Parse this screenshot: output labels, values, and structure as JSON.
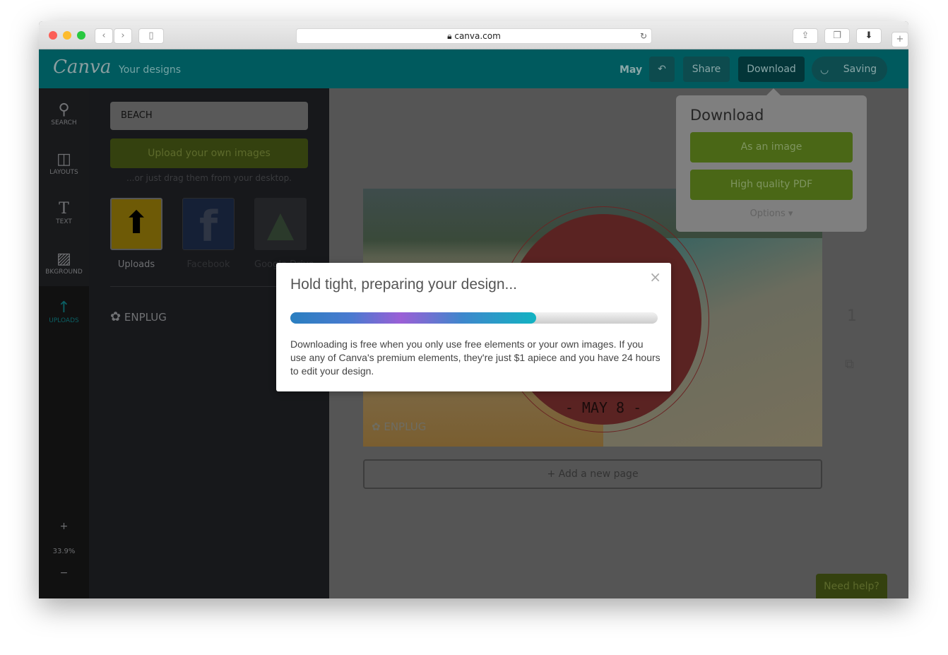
{
  "browser": {
    "url": "canva.com"
  },
  "header": {
    "logo": "Canva",
    "your_designs": "Your designs",
    "design_name": "May",
    "share": "Share",
    "download": "Download",
    "saving": "Saving"
  },
  "sidebar": {
    "items": [
      {
        "label": "SEARCH",
        "icon": "search-icon"
      },
      {
        "label": "LAYOUTS",
        "icon": "layouts-icon"
      },
      {
        "label": "TEXT",
        "icon": "text-icon"
      },
      {
        "label": "BKGROUND",
        "icon": "background-icon"
      },
      {
        "label": "UPLOADS",
        "icon": "upload-arrow-icon"
      }
    ],
    "zoom_level": "33.9%",
    "zoom_in": "+",
    "zoom_out": "−"
  },
  "panel": {
    "search_value": "BEACH",
    "upload_button": "Upload your own images",
    "hint": "...or just drag them from your desktop.",
    "sources": [
      {
        "label": "Uploads"
      },
      {
        "label": "Facebook"
      },
      {
        "label": "Google Drive"
      }
    ],
    "folder": "ENPLUG"
  },
  "design": {
    "date_text": "- MAY 8 -",
    "brand": "ENPLUG",
    "page_number": "1"
  },
  "add_page": "+ Add a new page",
  "help": "Need help?",
  "download_popover": {
    "title": "Download",
    "as_image": "As an image",
    "pdf": "High quality PDF",
    "options": "Options ▾"
  },
  "modal": {
    "title": "Hold tight, preparing your design...",
    "progress_percent": 67,
    "body": "Downloading is free when you only use free elements or your own images. If you use any of Canva's premium elements, they're just $1 apiece and you have 24 hours to edit your design.",
    "close": "×"
  },
  "colors": {
    "brand_teal": "#00c4cc",
    "green": "#7eb629"
  }
}
